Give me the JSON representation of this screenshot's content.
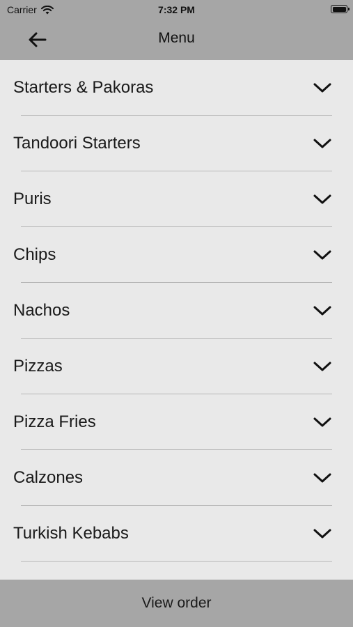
{
  "status_bar": {
    "carrier": "Carrier",
    "time": "7:32 PM"
  },
  "navbar": {
    "title": "Menu",
    "back_icon": "arrow-left-icon"
  },
  "categories": [
    {
      "label": "Starters & Pakoras"
    },
    {
      "label": "Tandoori Starters"
    },
    {
      "label": "Puris"
    },
    {
      "label": "Chips"
    },
    {
      "label": "Nachos"
    },
    {
      "label": "Pizzas"
    },
    {
      "label": "Pizza Fries"
    },
    {
      "label": "Calzones"
    },
    {
      "label": "Turkish Kebabs"
    }
  ],
  "footer": {
    "button_label": "View order"
  },
  "colors": {
    "bar_background": "#a6a6a6",
    "list_background": "#e9e9e9",
    "divider": "#b7b7b7"
  }
}
